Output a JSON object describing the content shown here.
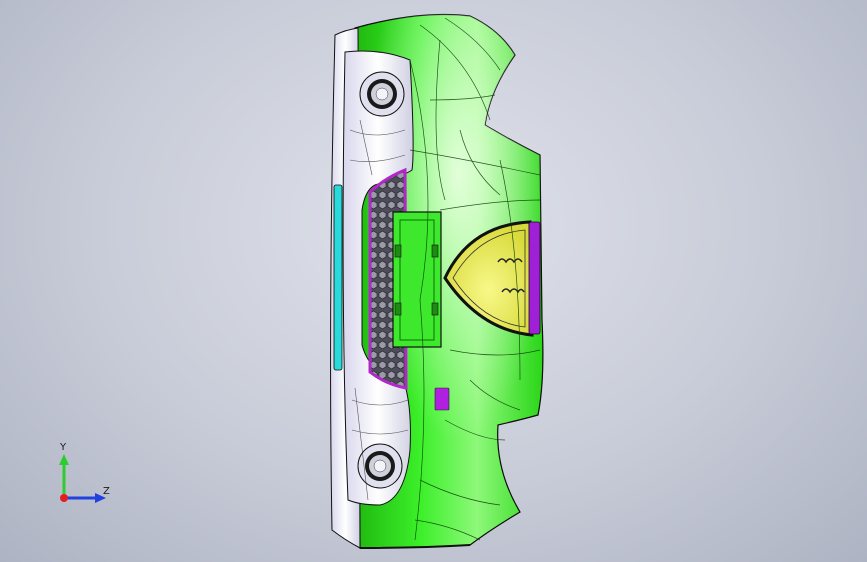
{
  "viewport": {
    "background_top": "#dfe2ea",
    "background_bottom": "#aeb3c3"
  },
  "model": {
    "body_color": "#2ee81a",
    "body_shade_color": "#1fb80f",
    "grille_accent_color": "#b028c8",
    "emblem_fill_color": "#eef060",
    "side_accent_color": "#a020d8",
    "light_panel_color": "#eef0f6",
    "cyan_strip_color": "#2adada",
    "edge_color": "#101010",
    "fog_lamps": 2
  },
  "triad": {
    "y_label": "Y",
    "z_label": "Z",
    "y_color": "#2ecc2e",
    "z_color": "#2040e0",
    "x_color": "#e02020"
  }
}
